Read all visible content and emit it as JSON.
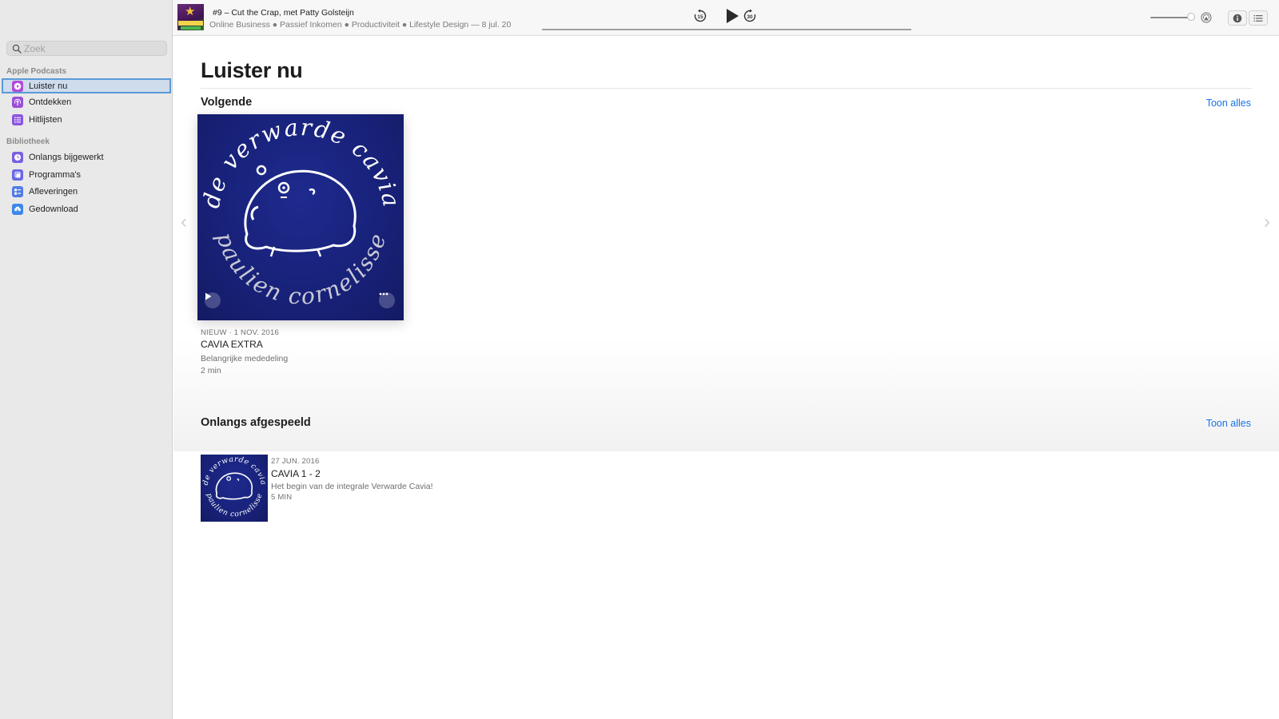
{
  "sidebar": {
    "search_placeholder": "Zoek",
    "sections": [
      {
        "heading": "Apple Podcasts",
        "items": [
          {
            "label": "Luister nu",
            "icon": "play-circle-icon",
            "color": "#b24ad8"
          },
          {
            "label": "Ontdekken",
            "icon": "podcast-icon",
            "color": "#9b4fd9"
          },
          {
            "label": "Hitlijsten",
            "icon": "list-icon",
            "color": "#8b55e0"
          }
        ]
      },
      {
        "heading": "Bibliotheek",
        "items": [
          {
            "label": "Onlangs bijgewerkt",
            "icon": "clock-icon",
            "color": "#7a5fe2"
          },
          {
            "label": "Programma's",
            "icon": "stack-icon",
            "color": "#6a69e4"
          },
          {
            "label": "Afleveringen",
            "icon": "episodes-icon",
            "color": "#4f7ce6"
          },
          {
            "label": "Gedownload",
            "icon": "download-cloud-icon",
            "color": "#3b88e8"
          }
        ]
      }
    ]
  },
  "player": {
    "title": "#9 – Cut the Crap, met Patty Golsteijn",
    "subtitle": "Online Business ● Passief Inkomen ● Productiviteit ● Lifestyle Design — 8 jul. 20",
    "skip_back_seconds": "15",
    "skip_forward_seconds": "30",
    "progress": 0.0,
    "volume": 0.95
  },
  "main": {
    "page_title": "Luister nu",
    "up_next": {
      "heading": "Volgende",
      "see_all": "Toon alles",
      "episode": {
        "meta": "NIEUW · 1 NOV. 2016",
        "title": "CAVIA EXTRA",
        "description": "Belangrijke mededeling",
        "duration": "2 min"
      }
    },
    "recently_played": {
      "heading": "Onlangs afgespeeld",
      "see_all": "Toon alles",
      "episode": {
        "date": "27 JUN. 2016",
        "title": "CAVIA 1 - 2",
        "description": "Het begin van de integrale Verwarde Cavia!",
        "duration": "5 MIN"
      }
    },
    "artwork_text": {
      "top": "de verwarde cavia",
      "bottom": "paulien cornelisse"
    }
  },
  "colors": {
    "accent": "#1a73e8",
    "artwork_bg": "#18227a",
    "sidebar_bg": "#e9e9e9"
  }
}
